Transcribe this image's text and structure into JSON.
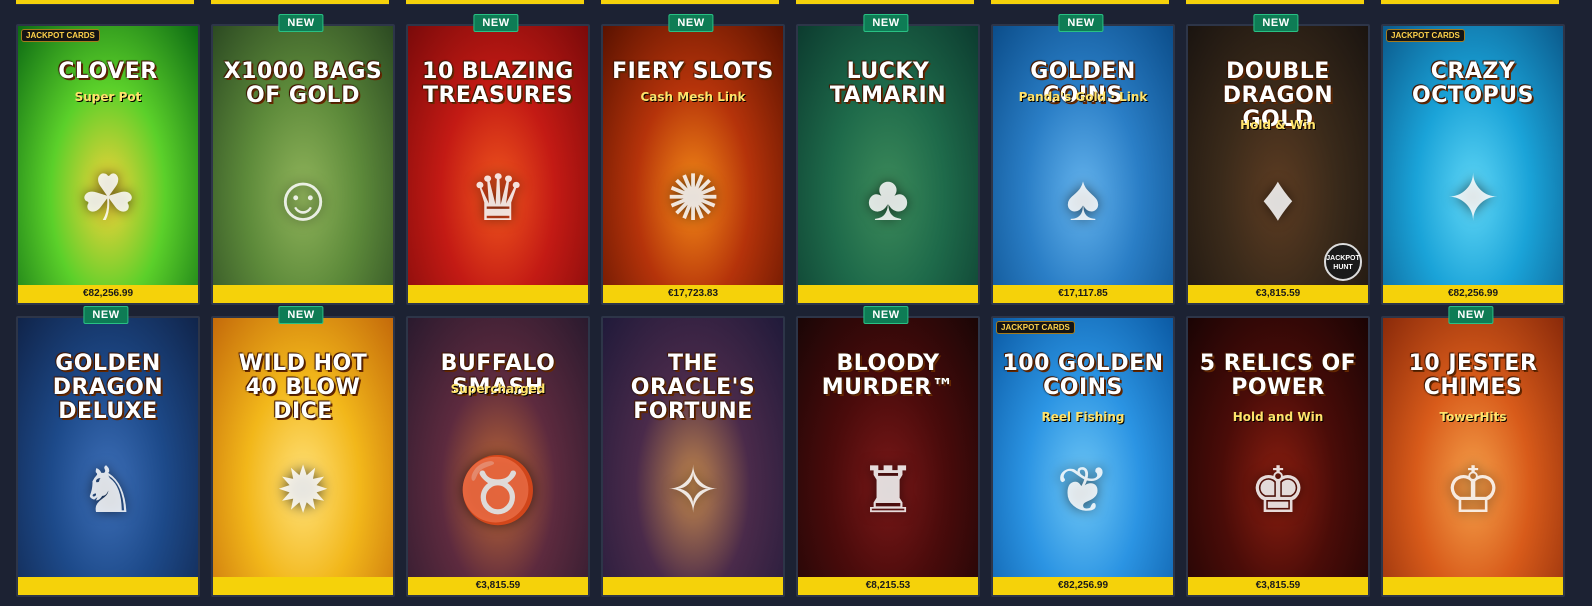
{
  "games": [
    {
      "title": "Clover",
      "subtitle": "Super Pot",
      "jackpot": "€82,256.99",
      "new": "",
      "badge_tag": "JACKPOT CARDS",
      "hunt": "",
      "colors": [
        "#0c6a13",
        "#5bd02a",
        "#f7d13a"
      ],
      "emblem": "☘"
    },
    {
      "title": "x1000 Bags of Gold",
      "subtitle": "",
      "jackpot": "",
      "new": "NEW",
      "badge_tag": "",
      "hunt": "",
      "colors": [
        "#2c4a22",
        "#5d8a3a",
        "#8fb35a"
      ],
      "emblem": "☺"
    },
    {
      "title": "10 Blazing Treasures",
      "subtitle": "",
      "jackpot": "",
      "new": "NEW",
      "badge_tag": "",
      "hunt": "",
      "colors": [
        "#7a0a0a",
        "#c31a14",
        "#f0561d"
      ],
      "emblem": "♛"
    },
    {
      "title": "Fiery Slots",
      "subtitle": "Cash Mesh Link",
      "jackpot": "€17,723.83",
      "new": "NEW",
      "badge_tag": "",
      "hunt": "",
      "colors": [
        "#5a1200",
        "#b5330a",
        "#f48a17"
      ],
      "emblem": "✺"
    },
    {
      "title": "Lucky Tamarin",
      "subtitle": "",
      "jackpot": "",
      "new": "NEW",
      "badge_tag": "",
      "hunt": "",
      "colors": [
        "#0c3b2f",
        "#1e6a4a",
        "#3c8a5a"
      ],
      "emblem": "♣"
    },
    {
      "title": "Golden Coins",
      "subtitle": "Panda's Gold · Link",
      "jackpot": "€17,117.85",
      "new": "NEW",
      "badge_tag": "",
      "hunt": "",
      "colors": [
        "#0b4d8a",
        "#2a7ec6",
        "#63b2ec"
      ],
      "emblem": "♠"
    },
    {
      "title": "Double Dragon Gold",
      "subtitle": "Hold & Win",
      "jackpot": "€3,815.59",
      "new": "NEW",
      "badge_tag": "",
      "hunt": "JACKPOT HUNT",
      "colors": [
        "#1a1410",
        "#3a2a1a",
        "#5d3c22"
      ],
      "emblem": "♦"
    },
    {
      "title": "Crazy Octopus",
      "subtitle": "",
      "jackpot": "€82,256.99",
      "new": "",
      "badge_tag": "JACKPOT CARDS",
      "hunt": "",
      "colors": [
        "#0b5a8c",
        "#1aa3d8",
        "#5fd6f6"
      ],
      "emblem": "✦"
    },
    {
      "title": "Golden Dragon Deluxe",
      "subtitle": "",
      "jackpot": "",
      "new": "NEW",
      "badge_tag": "",
      "hunt": "",
      "colors": [
        "#10244a",
        "#1d4a8a",
        "#3d6fb8"
      ],
      "emblem": "♞"
    },
    {
      "title": "Wild Hot 40 Blow Dice",
      "subtitle": "",
      "jackpot": "",
      "new": "NEW",
      "badge_tag": "",
      "hunt": "",
      "colors": [
        "#c46a0a",
        "#f2b71a",
        "#ffe17a"
      ],
      "emblem": "✹"
    },
    {
      "title": "Buffalo Smash",
      "subtitle": "Supercharged",
      "jackpot": "€3,815.59",
      "new": "",
      "badge_tag": "",
      "hunt": "",
      "colors": [
        "#2a1a2e",
        "#5d2a3e",
        "#c06a36"
      ],
      "emblem": "♉"
    },
    {
      "title": "The Oracle's Fortune",
      "subtitle": "",
      "jackpot": "",
      "new": "",
      "badge_tag": "",
      "hunt": "",
      "colors": [
        "#201a3a",
        "#4a2a4a",
        "#c2874d"
      ],
      "emblem": "✧"
    },
    {
      "title": "Bloody Murder™",
      "subtitle": "",
      "jackpot": "€8,215.53",
      "new": "NEW",
      "badge_tag": "",
      "hunt": "",
      "colors": [
        "#1a0606",
        "#4a0b0b",
        "#7a1818"
      ],
      "emblem": "♜"
    },
    {
      "title": "100 Golden Coins",
      "subtitle": "Reel Fishing",
      "jackpot": "€82,256.99",
      "new": "",
      "badge_tag": "JACKPOT CARDS",
      "hunt": "",
      "colors": [
        "#0b5aa4",
        "#2b94e3",
        "#6ec6f5"
      ],
      "emblem": "❦"
    },
    {
      "title": "5 Relics of Power",
      "subtitle": "Hold and Win",
      "jackpot": "€3,815.59",
      "new": "",
      "badge_tag": "",
      "hunt": "",
      "colors": [
        "#1a0404",
        "#4a0c08",
        "#8a1e10"
      ],
      "emblem": "♚"
    },
    {
      "title": "10 Jester Chimes",
      "subtitle": "TowerHits",
      "jackpot": "",
      "new": "NEW",
      "badge_tag": "",
      "hunt": "",
      "colors": [
        "#8a2a0a",
        "#d85b1a",
        "#f5a04a"
      ],
      "emblem": "♔"
    }
  ]
}
